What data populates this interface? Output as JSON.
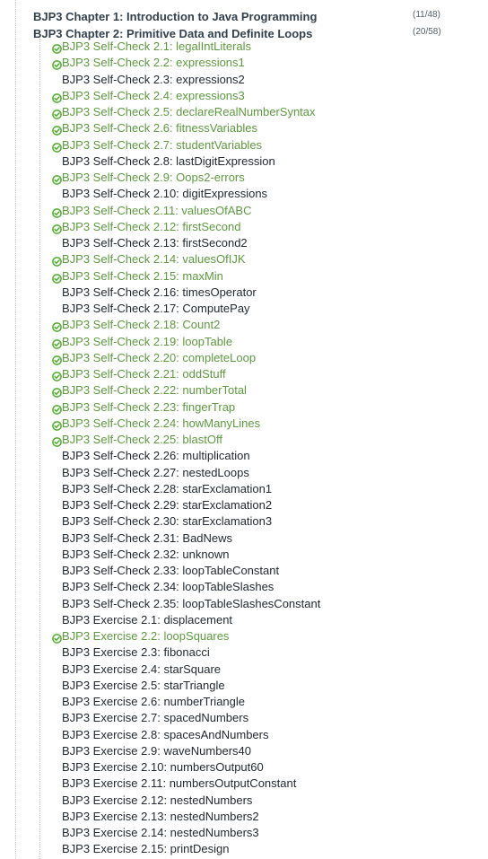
{
  "colors": {
    "completed_text": "#5d9a3f",
    "pending_text": "#222a33",
    "chapter_text": "#33414e",
    "check_icon": "#4caf2a"
  },
  "chapters": [
    {
      "title": "BJP3 Chapter 1: Introduction to Java Programming",
      "count": "(11/48)"
    },
    {
      "title": "BJP3 Chapter 2: Primitive Data and Definite Loops",
      "count": "(20/58)"
    }
  ],
  "problems": [
    {
      "label": "BJP3 Self-Check 2.1: legalIntLiterals",
      "completed": true,
      "icon": "check-circle-icon"
    },
    {
      "label": "BJP3 Self-Check 2.2: expressions1",
      "completed": true,
      "icon": "check-circle-icon"
    },
    {
      "label": "BJP3 Self-Check 2.3: expressions2",
      "completed": false
    },
    {
      "label": "BJP3 Self-Check 2.4: expressions3",
      "completed": true,
      "icon": "check-circle-icon"
    },
    {
      "label": "BJP3 Self-Check 2.5: declareRealNumberSyntax",
      "completed": true,
      "icon": "check-circle-icon"
    },
    {
      "label": "BJP3 Self-Check 2.6: fitnessVariables",
      "completed": true,
      "icon": "check-circle-icon"
    },
    {
      "label": "BJP3 Self-Check 2.7: studentVariables",
      "completed": true,
      "icon": "check-circle-icon"
    },
    {
      "label": "BJP3 Self-Check 2.8: lastDigitExpression",
      "completed": false
    },
    {
      "label": "BJP3 Self-Check 2.9: Oops2-errors",
      "completed": true,
      "icon": "check-circle-icon"
    },
    {
      "label": "BJP3 Self-Check 2.10: digitExpressions",
      "completed": false
    },
    {
      "label": "BJP3 Self-Check 2.11: valuesOfABC",
      "completed": true,
      "icon": "check-circle-icon"
    },
    {
      "label": "BJP3 Self-Check 2.12: firstSecond",
      "completed": true,
      "icon": "check-circle-icon"
    },
    {
      "label": "BJP3 Self-Check 2.13: firstSecond2",
      "completed": false
    },
    {
      "label": "BJP3 Self-Check 2.14: valuesOfIJK",
      "completed": true,
      "icon": "check-circle-icon"
    },
    {
      "label": "BJP3 Self-Check 2.15: maxMin",
      "completed": true,
      "icon": "check-circle-icon"
    },
    {
      "label": "BJP3 Self-Check 2.16: timesOperator",
      "completed": false
    },
    {
      "label": "BJP3 Self-Check 2.17: ComputePay",
      "completed": false
    },
    {
      "label": "BJP3 Self-Check 2.18: Count2",
      "completed": true,
      "icon": "check-circle-icon"
    },
    {
      "label": "BJP3 Self-Check 2.19: loopTable",
      "completed": true,
      "icon": "check-circle-icon"
    },
    {
      "label": "BJP3 Self-Check 2.20: completeLoop",
      "completed": true,
      "icon": "check-circle-icon"
    },
    {
      "label": "BJP3 Self-Check 2.21: oddStuff",
      "completed": true,
      "icon": "check-circle-icon"
    },
    {
      "label": "BJP3 Self-Check 2.22: numberTotal",
      "completed": true,
      "icon": "check-circle-icon"
    },
    {
      "label": "BJP3 Self-Check 2.23: fingerTrap",
      "completed": true,
      "icon": "check-circle-icon"
    },
    {
      "label": "BJP3 Self-Check 2.24: howManyLines",
      "completed": true,
      "icon": "check-circle-icon"
    },
    {
      "label": "BJP3 Self-Check 2.25: blastOff",
      "completed": true,
      "icon": "check-circle-icon"
    },
    {
      "label": "BJP3 Self-Check 2.26: multiplication",
      "completed": false
    },
    {
      "label": "BJP3 Self-Check 2.27: nestedLoops",
      "completed": false
    },
    {
      "label": "BJP3 Self-Check 2.28: starExclamation1",
      "completed": false
    },
    {
      "label": "BJP3 Self-Check 2.29: starExclamation2",
      "completed": false
    },
    {
      "label": "BJP3 Self-Check 2.30: starExclamation3",
      "completed": false
    },
    {
      "label": "BJP3 Self-Check 2.31: BadNews",
      "completed": false
    },
    {
      "label": "BJP3 Self-Check 2.32: unknown",
      "completed": false
    },
    {
      "label": "BJP3 Self-Check 2.33: loopTableConstant",
      "completed": false
    },
    {
      "label": "BJP3 Self-Check 2.34: loopTableSlashes",
      "completed": false
    },
    {
      "label": "BJP3 Self-Check 2.35: loopTableSlashesConstant",
      "completed": false
    },
    {
      "label": "BJP3 Exercise 2.1: displacement",
      "completed": false
    },
    {
      "label": "BJP3 Exercise 2.2: loopSquares",
      "completed": true,
      "icon": "check-circle-icon"
    },
    {
      "label": "BJP3 Exercise 2.3: fibonacci",
      "completed": false
    },
    {
      "label": "BJP3 Exercise 2.4: starSquare",
      "completed": false
    },
    {
      "label": "BJP3 Exercise 2.5: starTriangle",
      "completed": false
    },
    {
      "label": "BJP3 Exercise 2.6: numberTriangle",
      "completed": false
    },
    {
      "label": "BJP3 Exercise 2.7: spacedNumbers",
      "completed": false
    },
    {
      "label": "BJP3 Exercise 2.8: spacesAndNumbers",
      "completed": false
    },
    {
      "label": "BJP3 Exercise 2.9: waveNumbers40",
      "completed": false
    },
    {
      "label": "BJP3 Exercise 2.10: numbersOutput60",
      "completed": false
    },
    {
      "label": "BJP3 Exercise 2.11: numbersOutputConstant",
      "completed": false
    },
    {
      "label": "BJP3 Exercise 2.12: nestedNumbers",
      "completed": false
    },
    {
      "label": "BJP3 Exercise 2.13: nestedNumbers2",
      "completed": false
    },
    {
      "label": "BJP3 Exercise 2.14: nestedNumbers3",
      "completed": false
    },
    {
      "label": "BJP3 Exercise 2.15: printDesign",
      "completed": false
    }
  ]
}
